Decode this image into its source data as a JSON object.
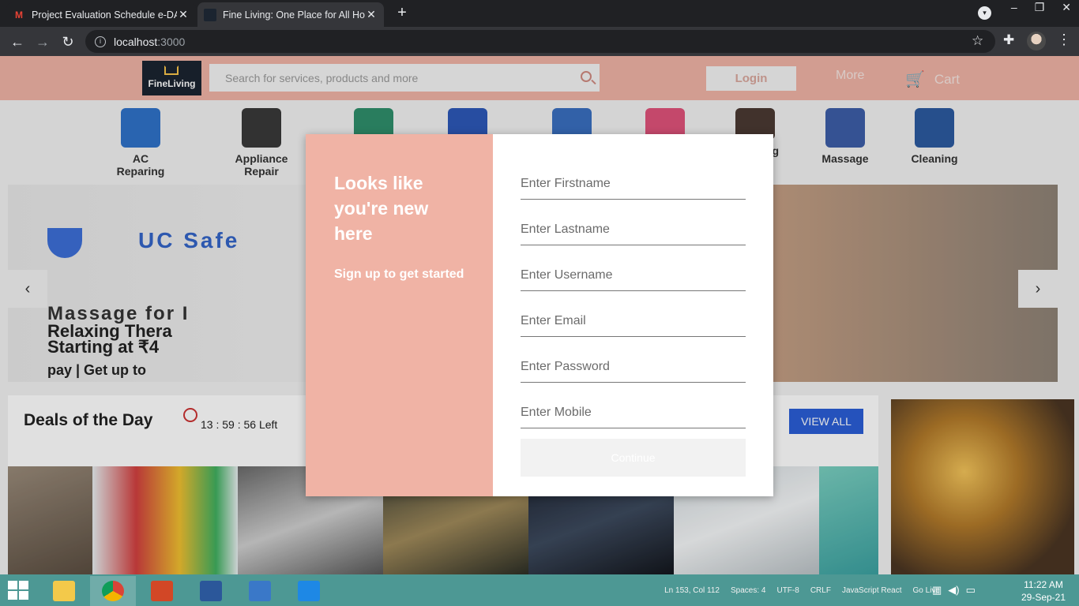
{
  "browser": {
    "tabs": [
      {
        "title": "Project Evaluation Schedule e-DA",
        "favicon": "gmail-icon"
      },
      {
        "title": "Fine Living: One Place for All Hou",
        "favicon": "fineliving-icon"
      }
    ],
    "url_host": "localhost",
    "url_port": ":3000"
  },
  "header": {
    "logo_text": "FineLiving",
    "search_placeholder": "Search for services, products and more",
    "login_label": "Login",
    "more_label": "More",
    "cart_label": "Cart"
  },
  "categories": [
    {
      "label": "AC Reparing",
      "color": "#2f72c9"
    },
    {
      "label": "Appliance Repair",
      "color": "#3a3a3a"
    },
    {
      "label": "",
      "color": "#2f8f6b"
    },
    {
      "label": "",
      "color": "#2d58b8"
    },
    {
      "label": "",
      "color": "#3a6fc0"
    },
    {
      "label": "",
      "color": "#e0527a"
    },
    {
      "label": "g",
      "color": "#4a3a33"
    },
    {
      "label": "Massage",
      "color": "#3d5ea8"
    },
    {
      "label": "Cleaning",
      "color": "#2c5aa0"
    }
  ],
  "banner": {
    "brand": "UC Safe",
    "line1": "Massage for I",
    "line2": "Relaxing Thera",
    "line3": "Starting at ₹4",
    "line4": "pay | Get up to"
  },
  "deals": {
    "title": "Deals of the Day",
    "timer": "13 : 59 : 56 Left",
    "view_all": "VIEW ALL"
  },
  "modal": {
    "heading": "Looks like you're new here",
    "subheading": "Sign up to get started",
    "fields": [
      "Enter Firstname",
      "Enter Lastname",
      "Enter Username",
      "Enter Email",
      "Enter Password",
      "Enter Mobile"
    ],
    "continue_label": "Continue"
  },
  "statusbar": {
    "position": "Ln 153, Col 112",
    "spaces": "Spaces: 4",
    "encoding": "UTF-8",
    "eol": "CRLF",
    "language": "JavaScript React",
    "golive": "Go Live"
  },
  "clock": {
    "time": "11:22 AM",
    "date": "29-Sep-21"
  }
}
